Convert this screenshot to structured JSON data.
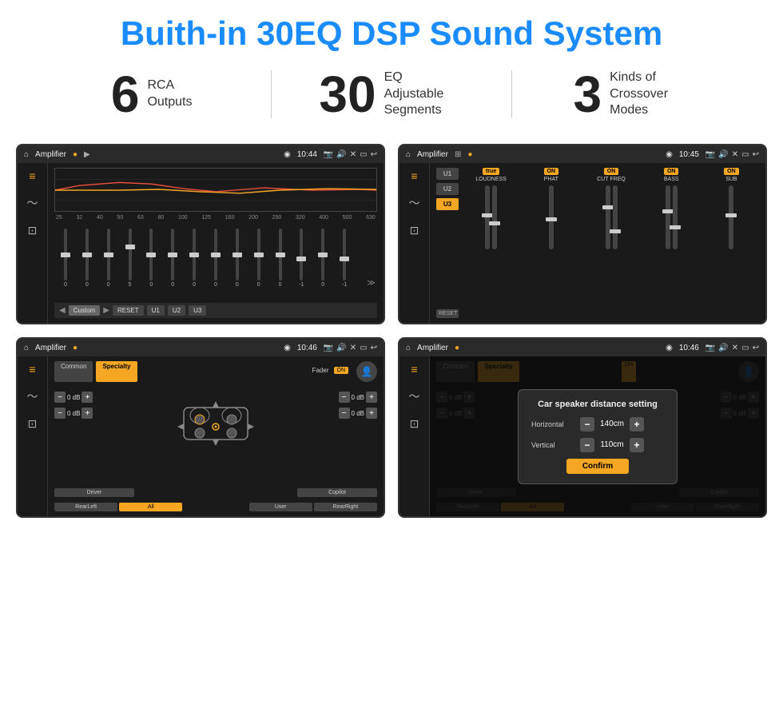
{
  "header": {
    "title": "Buith-in 30EQ DSP Sound System"
  },
  "stats": [
    {
      "number": "6",
      "label_line1": "RCA",
      "label_line2": "Outputs"
    },
    {
      "number": "30",
      "label_line1": "EQ Adjustable",
      "label_line2": "Segments"
    },
    {
      "number": "3",
      "label_line1": "Kinds of",
      "label_line2": "Crossover Modes"
    }
  ],
  "screen1": {
    "topbar": {
      "title": "Amplifier",
      "time": "10:44"
    },
    "freqs": [
      "25",
      "32",
      "40",
      "50",
      "63",
      "80",
      "100",
      "125",
      "160",
      "200",
      "250",
      "320",
      "400",
      "500",
      "630"
    ],
    "slider_values": [
      "0",
      "0",
      "0",
      "5",
      "0",
      "0",
      "0",
      "0",
      "0",
      "0",
      "0",
      "-1",
      "0",
      "-1"
    ],
    "buttons": [
      "Custom",
      "RESET",
      "U1",
      "U2",
      "U3"
    ]
  },
  "screen2": {
    "topbar": {
      "title": "Amplifier",
      "time": "10:45"
    },
    "presets": [
      "U1",
      "U2",
      "U3"
    ],
    "bands": [
      {
        "label": "LOUDNESS",
        "on": true
      },
      {
        "label": "PHAT",
        "on": true
      },
      {
        "label": "CUT FREQ",
        "on": true
      },
      {
        "label": "BASS",
        "on": true
      },
      {
        "label": "SUB",
        "on": true
      }
    ]
  },
  "screen3": {
    "topbar": {
      "title": "Amplifier",
      "time": "10:46"
    },
    "tabs": [
      "Common",
      "Specialty"
    ],
    "active_tab": "Specialty",
    "fader_label": "Fader",
    "fader_on": "ON",
    "levels": [
      "0 dB",
      "0 dB",
      "0 dB",
      "0 dB"
    ],
    "bottom_buttons": [
      "Driver",
      "",
      "Copilot",
      "RearLeft",
      "All",
      "",
      "User",
      "RearRight"
    ]
  },
  "screen4": {
    "topbar": {
      "title": "Amplifier",
      "time": "10:46"
    },
    "tabs": [
      "Common",
      "Specialty"
    ],
    "active_tab": "Specialty",
    "dialog": {
      "title": "Car speaker distance setting",
      "horizontal_label": "Horizontal",
      "horizontal_value": "140cm",
      "vertical_label": "Vertical",
      "vertical_value": "110cm",
      "confirm_label": "Confirm"
    }
  },
  "icons": {
    "home": "⌂",
    "location": "◉",
    "volume": "🔊",
    "back": "↩",
    "equalizer": "≡",
    "waveform": "〜",
    "speaker": "⊡",
    "expand": "≫",
    "play": "▶",
    "prev": "◀",
    "minus": "−",
    "plus": "+"
  }
}
